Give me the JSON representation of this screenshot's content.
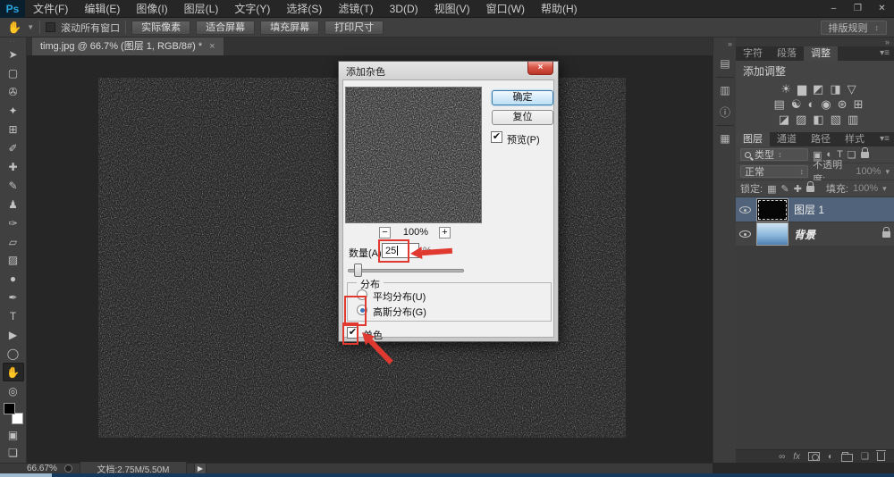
{
  "colors": {
    "annotation_red": "#e0392f",
    "selected_layer_bg": "#50637a",
    "ps_logo_blue": "#2aa9e0",
    "default_button_border": "#3a7bab"
  },
  "menu": {
    "logo": "Ps",
    "items": [
      "文件(F)",
      "编辑(E)",
      "图像(I)",
      "图层(L)",
      "文字(Y)",
      "选择(S)",
      "滤镜(T)",
      "3D(D)",
      "视图(V)",
      "窗口(W)",
      "帮助(H)"
    ],
    "window_controls": {
      "minimize": "–",
      "restore": "❐",
      "close": "✕"
    }
  },
  "options_bar": {
    "hand_icon": "✋",
    "scroll_all_label": "滚动所有窗口",
    "buttons": [
      "实际像素",
      "适合屏幕",
      "填充屏幕",
      "打印尺寸"
    ],
    "workspace": "排版规则"
  },
  "document_tab": {
    "title": "timg.jpg @ 66.7% (图层 1, RGB/8#) *",
    "close": "×"
  },
  "tools": [
    {
      "name": "move",
      "glyph": "➤"
    },
    {
      "name": "marquee",
      "glyph": "▢"
    },
    {
      "name": "lasso",
      "glyph": "✇"
    },
    {
      "name": "magic-wand",
      "glyph": "✦"
    },
    {
      "name": "crop",
      "glyph": "⊞"
    },
    {
      "name": "eyedropper",
      "glyph": "✐"
    },
    {
      "name": "healing-brush",
      "glyph": "✚"
    },
    {
      "name": "brush",
      "glyph": "✎"
    },
    {
      "name": "clone-stamp",
      "glyph": "♟"
    },
    {
      "name": "history-brush",
      "glyph": "✑"
    },
    {
      "name": "eraser",
      "glyph": "▱"
    },
    {
      "name": "gradient",
      "glyph": "▨"
    },
    {
      "name": "blur",
      "glyph": "●"
    },
    {
      "name": "pen",
      "glyph": "✒"
    },
    {
      "name": "type",
      "glyph": "T"
    },
    {
      "name": "path-select",
      "glyph": "▶"
    },
    {
      "name": "shape",
      "glyph": "◯"
    },
    {
      "name": "hand",
      "glyph": "✋"
    },
    {
      "name": "zoom",
      "glyph": "◎"
    }
  ],
  "tools_extra": {
    "quick_mask": "▣",
    "screen_mode": "❏"
  },
  "collapsed_strip": {
    "collapse": "»",
    "icons": [
      "▤",
      "▥",
      "ⓘ",
      "▦"
    ]
  },
  "dialog": {
    "title": "添加杂色",
    "close": "×",
    "ok": "确定",
    "reset": "复位",
    "preview_label": "预览(P)",
    "check_glyph": "✔",
    "zoom_out": "−",
    "zoom_value": "100%",
    "zoom_in": "+",
    "amount_label": "数量(A):",
    "amount_value": "25",
    "percent": "%",
    "distribution_label": "分布",
    "uniform_label": "平均分布(U)",
    "gaussian_label": "高斯分布(G)",
    "monochrome_label": "单色"
  },
  "right_panels": {
    "collapse": "»",
    "top_tabs": [
      "字符",
      "段落",
      "调整"
    ],
    "tab_menu": "▾≡",
    "adjustments_title": "添加调整",
    "adj_row1": [
      "☀",
      "▆",
      "◩",
      "◨",
      "▽"
    ],
    "adj_row2": [
      "▤",
      "☯",
      "◐",
      "◉",
      "⊛",
      "⊞"
    ],
    "adj_row3": [
      "◪",
      "▨",
      "◧",
      "▧",
      "▥"
    ],
    "layer_tabs": [
      "图层",
      "通道",
      "路径",
      "样式"
    ],
    "filter_type_label": "类型",
    "filter_icons": [
      "▣",
      "◐",
      "T",
      "❏"
    ],
    "blend_mode": "正常",
    "opacity_label": "不透明度:",
    "opacity_value": "100%",
    "lock_label": "锁定:",
    "lock_icons": [
      "▦",
      "✎",
      "✚"
    ],
    "fill_label": "填充:",
    "fill_value": "100%",
    "layers": [
      {
        "name": "图层 1",
        "selected": true
      },
      {
        "name": "背景",
        "locked": true
      }
    ],
    "bottom_icons": {
      "link": "∞",
      "fx": "fx",
      "adjustment": "◐",
      "new_layer": "❏"
    }
  },
  "status_bar": {
    "zoom": "66.67%",
    "doc_info": "文档:2.75M/5.50M",
    "expand": "▶"
  }
}
